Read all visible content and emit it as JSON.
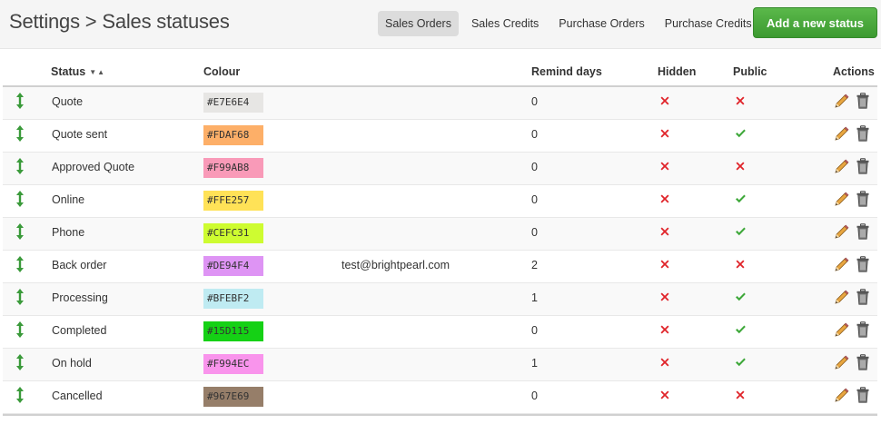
{
  "header": {
    "title": "Settings > Sales statuses",
    "tabs": [
      {
        "label": "Sales Orders",
        "active": true
      },
      {
        "label": "Sales Credits",
        "active": false
      },
      {
        "label": "Purchase Orders",
        "active": false
      },
      {
        "label": "Purchase Credits",
        "active": false
      }
    ],
    "add_button_label": "Add a new status"
  },
  "table": {
    "columns": {
      "status": "Status",
      "colour": "Colour",
      "remind_days": "Remind days",
      "hidden": "Hidden",
      "public": "Public",
      "actions": "Actions"
    },
    "sort_icon": "▼▲",
    "rows": [
      {
        "status": "Quote",
        "colour": "#E7E6E4",
        "email": "",
        "remind_days": "0",
        "hidden": false,
        "public": false
      },
      {
        "status": "Quote sent",
        "colour": "#FDAF68",
        "email": "",
        "remind_days": "0",
        "hidden": false,
        "public": true
      },
      {
        "status": "Approved Quote",
        "colour": "#F99AB8",
        "email": "",
        "remind_days": "0",
        "hidden": false,
        "public": false
      },
      {
        "status": "Online",
        "colour": "#FFE257",
        "email": "",
        "remind_days": "0",
        "hidden": false,
        "public": true
      },
      {
        "status": "Phone",
        "colour": "#CEFC31",
        "email": "",
        "remind_days": "0",
        "hidden": false,
        "public": true
      },
      {
        "status": "Back order",
        "colour": "#DE94F4",
        "email": "test@brightpearl.com",
        "remind_days": "2",
        "hidden": false,
        "public": false
      },
      {
        "status": "Processing",
        "colour": "#BFEBF2",
        "email": "",
        "remind_days": "1",
        "hidden": false,
        "public": true
      },
      {
        "status": "Completed",
        "colour": "#15D115",
        "email": "",
        "remind_days": "0",
        "hidden": false,
        "public": true
      },
      {
        "status": "On hold",
        "colour": "#F994EC",
        "email": "",
        "remind_days": "1",
        "hidden": false,
        "public": true
      },
      {
        "status": "Cancelled",
        "colour": "#967E69",
        "email": "",
        "remind_days": "0",
        "hidden": false,
        "public": false
      }
    ]
  },
  "icons": {
    "drag": "drag-handle-icon",
    "false": "red-cross-icon",
    "true": "green-check-icon",
    "edit": "pencil-icon",
    "delete": "trash-icon"
  },
  "colors": {
    "accent_green": "#4cae3f",
    "cross_red": "#e0242a",
    "check_green": "#3ea83a",
    "drag_green": "#3a9a3a"
  }
}
